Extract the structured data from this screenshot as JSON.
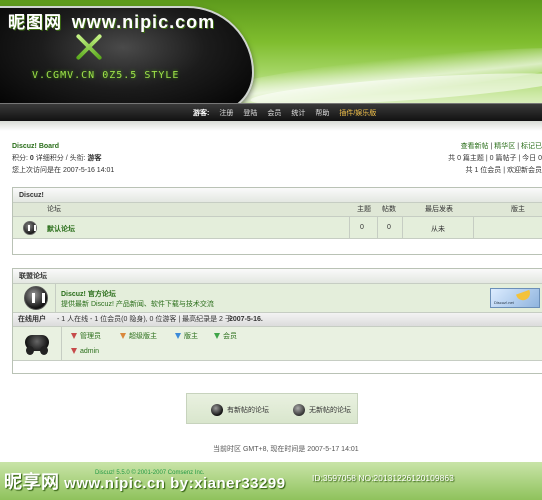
{
  "header": {
    "watermark_cn": "昵图网",
    "watermark_url": "www.nipic.com",
    "brand": "V.CGMV.CN 0Z5.5 STYLE"
  },
  "nav": {
    "guest": "游客:",
    "items": [
      "注册",
      "登陆",
      "会员",
      "统计",
      "帮助"
    ],
    "plugin": "插件/娱乐版"
  },
  "info_left": {
    "board": "Discuz! Board",
    "points_label": "积分:",
    "points": "0",
    "detail": "详细积分",
    "title_label": "/ 头衔:",
    "title": "游客",
    "last_visit": "您上次访问是在 2007-5-16 14:01"
  },
  "info_right": {
    "links": [
      "查看新帖",
      "精华区",
      "标记已"
    ],
    "stats1": "共 0 篇主题 | 0 篇帖子 | 今日 0",
    "stats2": "共 1 位会员 | 欢迎新会员"
  },
  "forum_table": {
    "caption": "Discuz!",
    "headers": {
      "forum": "论坛",
      "topics": "主题",
      "posts": "帖数",
      "last": "最后发表",
      "mods": "版主"
    },
    "rows": [
      {
        "name": "默认论坛",
        "topics": "0",
        "posts": "0",
        "last": "从未",
        "mods": ""
      }
    ]
  },
  "links_table": {
    "caption": "联盟论坛",
    "link_name": "Discuz! 官方论坛",
    "link_desc": "提供最新 Discuz! 产品新闻、软件下载与技术交流",
    "logo_text": "Discuz!.net",
    "online_label": "在线用户",
    "online_stats": "- 1 人在线 - 1 位会员(0 隐身), 0 位游客 | 最高纪录是 2 于",
    "online_record_date": "2007-5-16.",
    "roles": [
      {
        "label": "管理员",
        "color": "#c64a4a"
      },
      {
        "label": "超级版主",
        "color": "#d9873b"
      },
      {
        "label": "版主",
        "color": "#3b8ad9"
      },
      {
        "label": "会员",
        "color": "#3fa548"
      }
    ],
    "user": {
      "name": "admin",
      "color": "#c64a4a"
    }
  },
  "legend": {
    "new": "有新帖的论坛",
    "old": "无新帖的论坛"
  },
  "timezone": "当前时区 GMT+8, 现在时间是 2007-5-17 14:01",
  "footer": {
    "stamp": "Discuz!  5.5.0  © 2001-2007 Comsenz Inc.",
    "wm_cn": "昵享网",
    "wm_url": "www.nipic.cn",
    "wm_user": "by:xianer33299",
    "wm_id": "ID:3597058 NO:20131226120109863"
  }
}
